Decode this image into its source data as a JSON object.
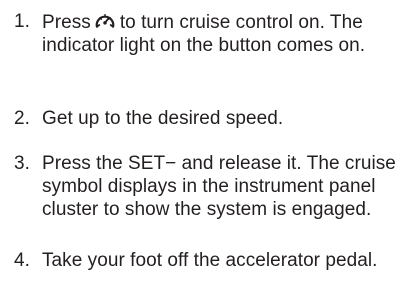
{
  "steps": [
    {
      "number": "1.",
      "before_icon": "Press",
      "icon": "cruise-control-icon",
      "after_icon": "to turn cruise control on. The indicator light on the button comes on."
    },
    {
      "number": "2.",
      "text": "Get up to the desired speed."
    },
    {
      "number": "3.",
      "text": "Press the SET− and release it. The cruise symbol displays in the instrument panel cluster to show the system is engaged."
    },
    {
      "number": "4.",
      "text": "Take your foot off the accelerator pedal."
    }
  ]
}
